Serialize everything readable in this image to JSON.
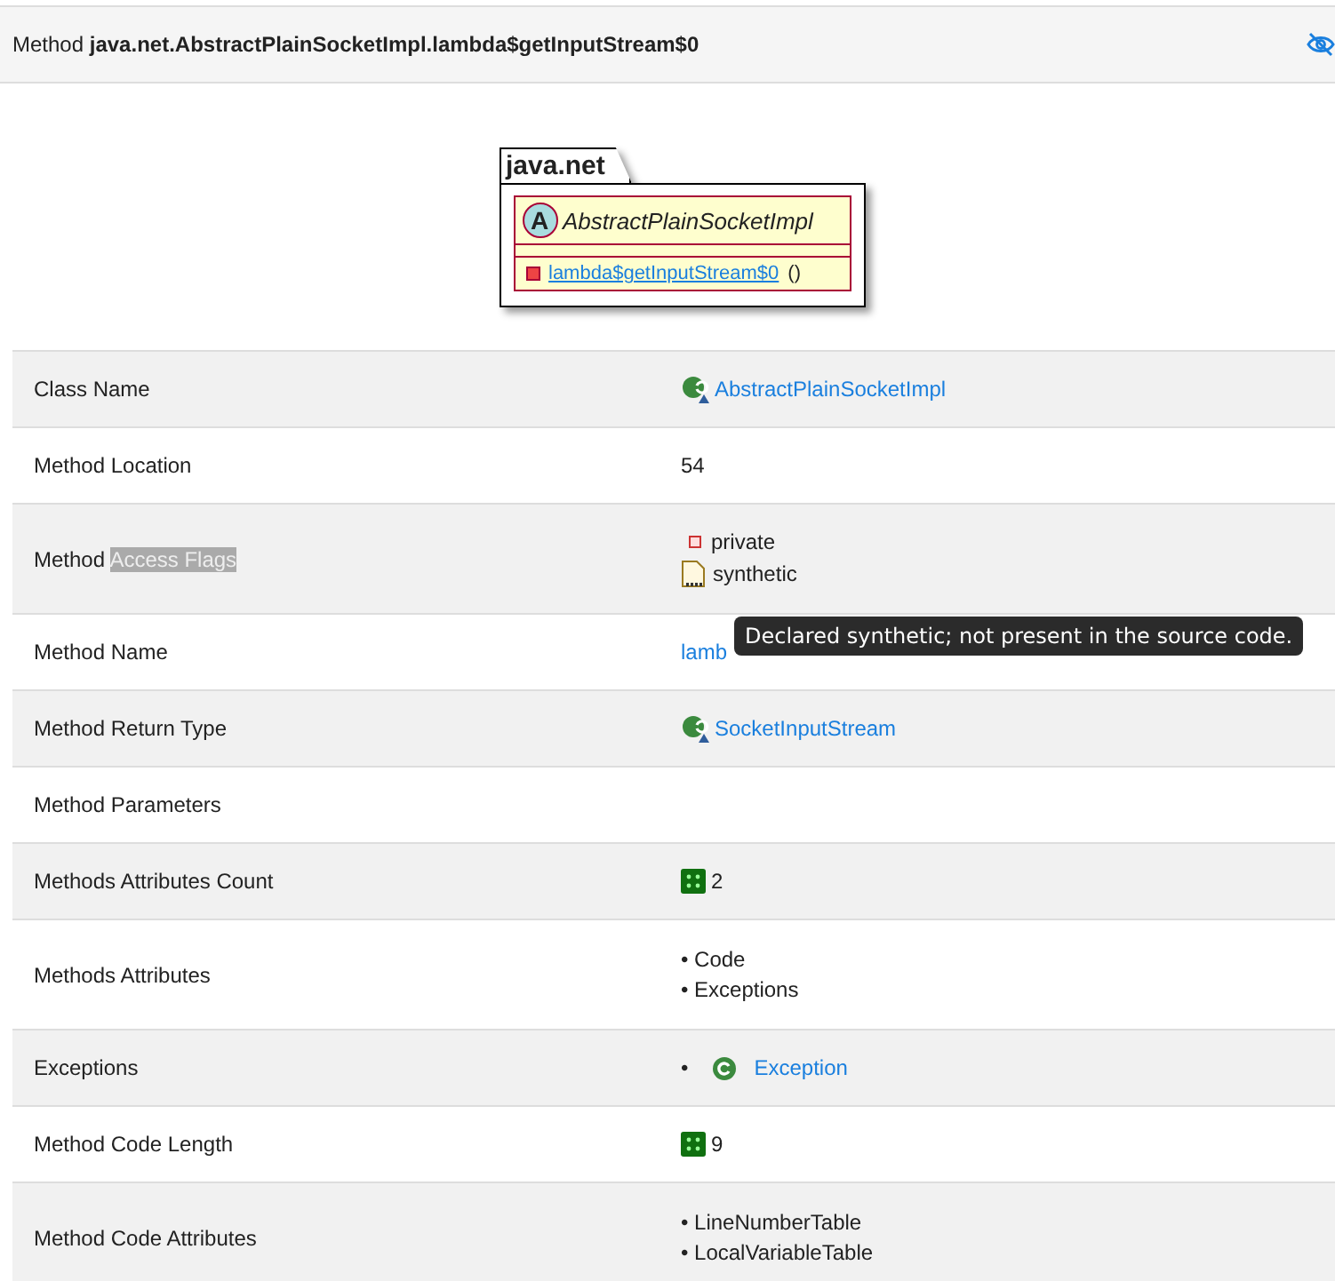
{
  "header": {
    "prefix": "Method",
    "title": "java.net.AbstractPlainSocketImpl.lambda$getInputStream$0"
  },
  "diagram": {
    "package": "java.net",
    "class_badge": "A",
    "class_name": "AbstractPlainSocketImpl",
    "method": {
      "name": "lambda$getInputStream$0",
      "suffix": "()"
    }
  },
  "rows": [
    {
      "label": "Class Name",
      "kind": "class_link",
      "value": "AbstractPlainSocketImpl"
    },
    {
      "label": "Method Location",
      "kind": "text",
      "value": "54"
    },
    {
      "label": "Method",
      "highlighted_text": "Access Flags",
      "kind": "flags",
      "items": [
        {
          "kind": "private",
          "text": "private"
        },
        {
          "kind": "synthetic",
          "text": "synthetic"
        }
      ]
    },
    {
      "label": "Method Name",
      "kind": "link",
      "value": "lamb"
    },
    {
      "label": "Method Return Type",
      "kind": "class_link",
      "value": "SocketInputStream"
    },
    {
      "label": "Method Parameters",
      "kind": "text"
    },
    {
      "label": "Methods Attributes Count",
      "kind": "count",
      "value": "2"
    },
    {
      "label": "Methods Attributes",
      "kind": "bullets",
      "items": [
        "• Code",
        "• Exceptions"
      ]
    },
    {
      "label": "Exceptions",
      "kind": "bullet_links",
      "items": [
        {
          "bullet": "•",
          "text": "Exception"
        }
      ]
    },
    {
      "label": "Method Code Length",
      "kind": "count",
      "value": "9"
    },
    {
      "label": "Method Code Attributes",
      "kind": "bullets",
      "items": [
        "• LineNumberTable",
        "• LocalVariableTable"
      ]
    }
  ],
  "tooltip": "Declared synthetic; not present in the source code."
}
